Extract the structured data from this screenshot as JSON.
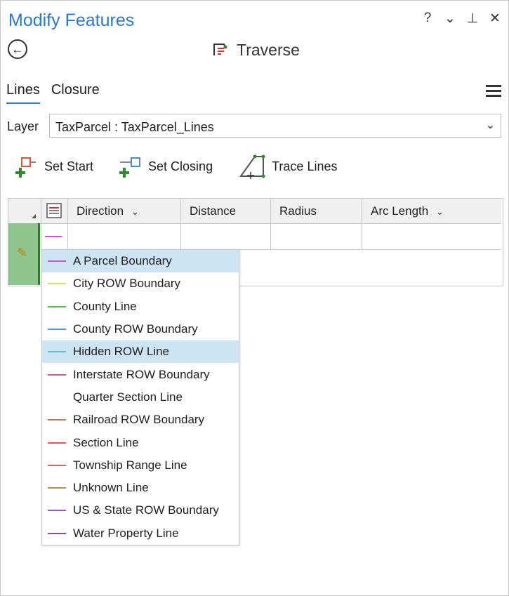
{
  "window": {
    "title": "Modify Features",
    "controls": [
      "?",
      "⌄",
      "⊥",
      "✕"
    ]
  },
  "tool": {
    "title": "Traverse"
  },
  "tabs": [
    {
      "label": "Lines",
      "active": true
    },
    {
      "label": "Closure",
      "active": false
    }
  ],
  "layer": {
    "label": "Layer",
    "value": "TaxParcel : TaxParcel_Lines"
  },
  "toolbar": {
    "set_start": "Set Start",
    "set_closing": "Set Closing",
    "trace_lines": "Trace Lines"
  },
  "grid": {
    "columns": [
      "Direction",
      "Distance",
      "Radius",
      "Arc Length"
    ]
  },
  "dropdown": {
    "items": [
      {
        "label": "A Parcel Boundary",
        "color": "#d64fd6"
      },
      {
        "label": "City ROW Boundary",
        "color": "#c8e66a"
      },
      {
        "label": "County Line",
        "color": "#58b84a"
      },
      {
        "label": "County ROW Boundary",
        "color": "#5a97e8"
      },
      {
        "label": "Hidden ROW Line",
        "color": "#5bc4c9"
      },
      {
        "label": "Interstate ROW Boundary",
        "color": "#d05a92"
      },
      {
        "label": "Quarter Section Line",
        "color": ""
      },
      {
        "label": "Railroad ROW Boundary",
        "color": "#c0785a"
      },
      {
        "label": "Section Line",
        "color": "#ef5454"
      },
      {
        "label": "Township Range Line",
        "color": "#ef5a5a"
      },
      {
        "label": "Unknown Line",
        "color": "#b09050"
      },
      {
        "label": "US & State ROW Boundary",
        "color": "#8e5ad6"
      },
      {
        "label": "Water Property Line",
        "color": "#7a52c9"
      }
    ]
  }
}
